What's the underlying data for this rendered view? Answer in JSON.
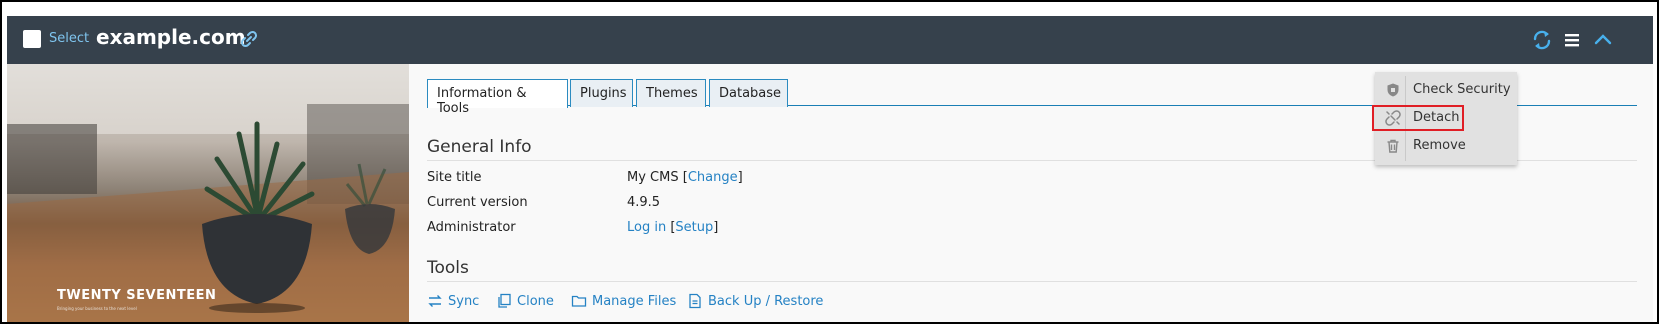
{
  "header": {
    "select_label": "Select",
    "domain": "example.com"
  },
  "thumbnail": {
    "theme_name": "TWENTY SEVENTEEN",
    "theme_tagline": "Bringing your business to the next level"
  },
  "tabs": [
    {
      "label": "Information & Tools",
      "active": true
    },
    {
      "label": "Plugins",
      "active": false
    },
    {
      "label": "Themes",
      "active": false
    },
    {
      "label": "Database",
      "active": false
    }
  ],
  "general_info": {
    "title": "General Info",
    "rows": [
      {
        "label": "Site title",
        "value": "My CMS",
        "link": "Change"
      },
      {
        "label": "Current version",
        "value": "4.9.5"
      },
      {
        "label": "Administrator",
        "link1": "Log in",
        "link2": "Setup"
      }
    ]
  },
  "tools": {
    "title": "Tools",
    "items": [
      {
        "label": "Sync",
        "icon": "sync-icon"
      },
      {
        "label": "Clone",
        "icon": "clone-icon"
      },
      {
        "label": "Manage Files",
        "icon": "folder-icon"
      },
      {
        "label": "Back Up / Restore",
        "icon": "backup-icon"
      }
    ]
  },
  "dropdown": {
    "items": [
      {
        "label": "Check Security",
        "icon": "shield-icon"
      },
      {
        "label": "Detach",
        "icon": "detach-icon",
        "highlighted": true
      },
      {
        "label": "Remove",
        "icon": "trash-icon"
      }
    ]
  },
  "colors": {
    "header_bg": "#36414c",
    "link": "#2582c4",
    "accent": "#1a7fb5",
    "highlight_border": "#e01e25"
  }
}
